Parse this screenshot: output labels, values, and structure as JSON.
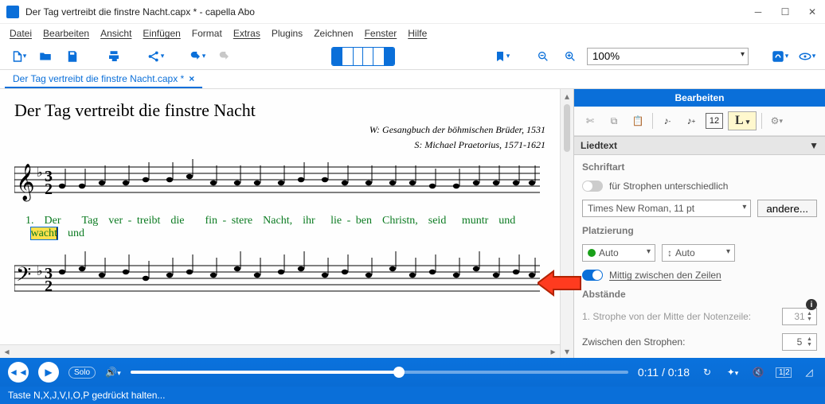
{
  "window": {
    "title": "Der Tag vertreibt die finstre Nacht.capx * - capella Abo"
  },
  "menu": {
    "file": "Datei",
    "edit": "Bearbeiten",
    "view": "Ansicht",
    "insert": "Einfügen",
    "format": "Format",
    "extras": "Extras",
    "plugins": "Plugins",
    "draw": "Zeichnen",
    "window": "Fenster",
    "help": "Hilfe"
  },
  "toolbar": {
    "zoom": "100%"
  },
  "tab": {
    "label": "Der Tag vertreibt die finstre Nacht.capx *"
  },
  "score": {
    "title": "Der Tag vertreibt die finstre Nacht",
    "credit1": "W: Gesangbuch der böhmischen Brüder, 1531",
    "credit2": "S: Michael Praetorius, 1571-1621"
  },
  "lyrics": {
    "verse": "1.",
    "parts": [
      "Der",
      "Tag",
      "ver -",
      "treibt",
      "die",
      "fin  -  stere",
      "Nacht,",
      "ihr",
      "lie  -  ben",
      "Christn,",
      "seid",
      "muntr",
      "und"
    ],
    "highlighted": "wacht",
    "tail": "und"
  },
  "side": {
    "header": "Bearbeiten",
    "lyrics_hdr": "Liedtext",
    "font_section": "Schriftart",
    "font_toggle": "für Strophen unterschiedlich",
    "font_dd": "Times New Roman, 11 pt",
    "font_btn": "andere...",
    "placement_section": "Platzierung",
    "auto1": "Auto",
    "auto2": "Auto",
    "mid_toggle": "Mittig zwischen den Zeilen",
    "distances_section": "Abstände",
    "dist1_lbl": "1. Strophe von der Mitte der Notenzeile:",
    "dist1_val": "31",
    "dist2_lbl": "Zwischen den Strophen:",
    "dist2_val": "5",
    "L": "L",
    "box": "12"
  },
  "play": {
    "time": "0:11 / 0:18",
    "solo": "Solo",
    "rec": "1|2"
  },
  "status": {
    "text": "Taste N,X,J,V,I,O,P gedrückt halten..."
  }
}
